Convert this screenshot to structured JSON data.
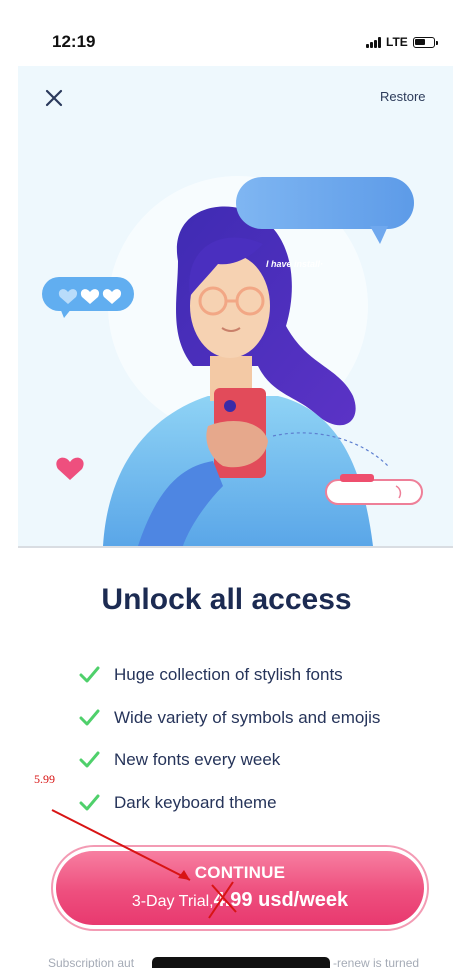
{
  "status_bar": {
    "time": "12:19",
    "network": "LTE",
    "battery_level": 0.6
  },
  "header": {
    "close_icon": "close-icon",
    "restore_label": "Restore"
  },
  "hero": {
    "message_bubble_text": "I have install·"
  },
  "title": "Unlock all access",
  "features": [
    {
      "label": "Huge collection of stylish fonts",
      "icon": "check-icon"
    },
    {
      "label": "Wide variety of symbols and emojis",
      "icon": "check-icon"
    },
    {
      "label": "New fonts every week",
      "icon": "check-icon"
    },
    {
      "label": "Dark keyboard theme",
      "icon": "check-icon"
    }
  ],
  "annotation": {
    "note": "5.99"
  },
  "cta": {
    "label": "CONTINUE",
    "trial": "3-Day Trial, ",
    "price": "4.99 usd/week"
  },
  "footer": {
    "left_text": "Subscription aut",
    "right_text": "-renew is turned"
  },
  "colors": {
    "title": "#1c2b52",
    "check": "#4fd06b",
    "cta_top": "#f77fa1",
    "cta_bottom": "#e8396f",
    "annotation": "#d81414",
    "hero_bg": "#eef8fd"
  }
}
